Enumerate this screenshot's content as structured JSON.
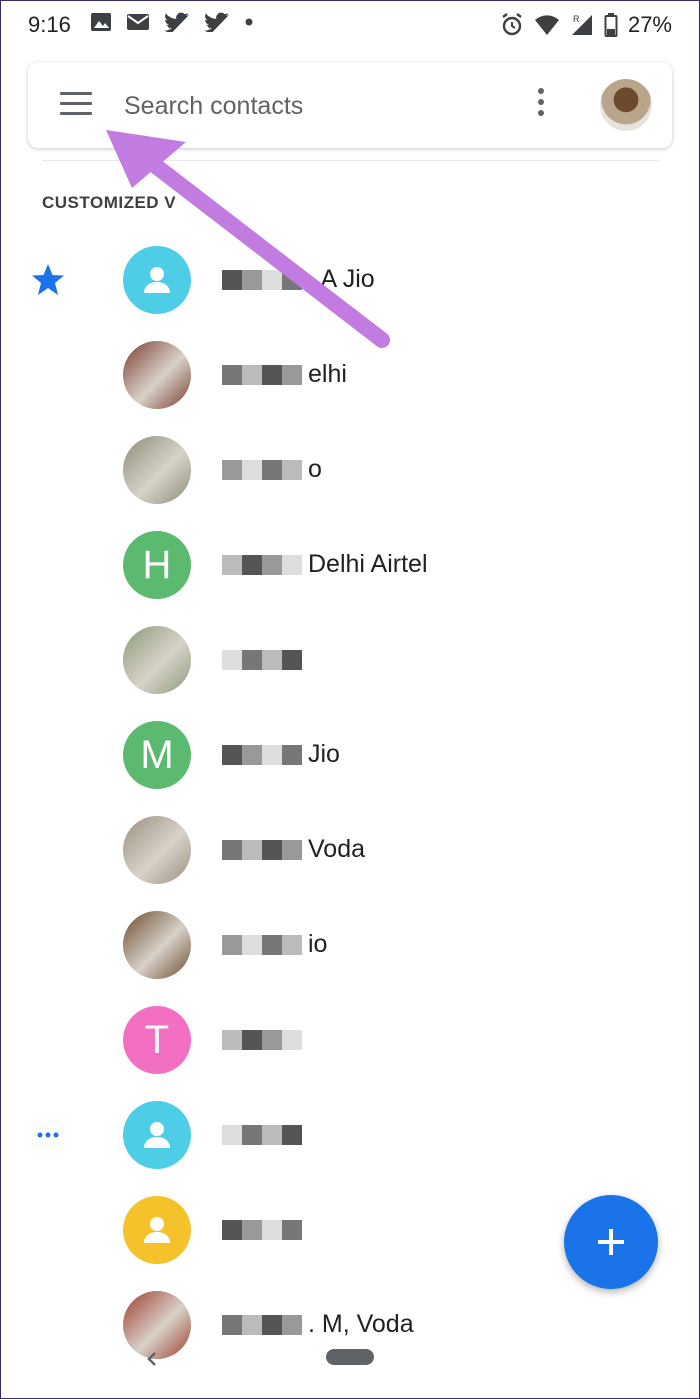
{
  "status_bar": {
    "time": "9:16",
    "battery_percent": "27%",
    "icons": [
      "image-icon",
      "mail-icon",
      "twitter-icon",
      "twitter-icon",
      "dot-icon",
      "alarm-icon",
      "wifi-icon",
      "signal-icon",
      "battery-icon"
    ]
  },
  "search": {
    "placeholder": "Search contacts"
  },
  "section": {
    "header": "CUSTOMIZED V"
  },
  "contacts": [
    {
      "name": ". A Jio",
      "avatar_type": "icon",
      "color": "#4ecde6",
      "mark": "star"
    },
    {
      "name": "elhi",
      "avatar_type": "photo",
      "color": "#7a3b2e"
    },
    {
      "name": "o",
      "avatar_type": "photo",
      "color": "#8c8c7a"
    },
    {
      "name": "Delhi Airtel",
      "avatar_type": "letter",
      "letter": "H",
      "color": "#5bba6f"
    },
    {
      "name": "",
      "avatar_type": "photo",
      "color": "#8a9a7a"
    },
    {
      "name": "Jio",
      "avatar_type": "letter",
      "letter": "M",
      "color": "#5bba6f"
    },
    {
      "name": "Voda",
      "avatar_type": "photo",
      "color": "#9a8f80"
    },
    {
      "name": "io",
      "avatar_type": "photo",
      "color": "#6b4a2e"
    },
    {
      "name": "",
      "avatar_type": "letter",
      "letter": "T",
      "color": "#f36fc2"
    },
    {
      "name": "",
      "avatar_type": "icon",
      "color": "#4ecde6",
      "mark": "dots"
    },
    {
      "name": "",
      "avatar_type": "icon",
      "color": "#f6c22b"
    },
    {
      "name": ". M, Voda",
      "avatar_type": "photo",
      "color": "#9b3b2b"
    }
  ],
  "colors": {
    "accent": "#1a73e8",
    "annotation_arrow": "#c27be0"
  }
}
